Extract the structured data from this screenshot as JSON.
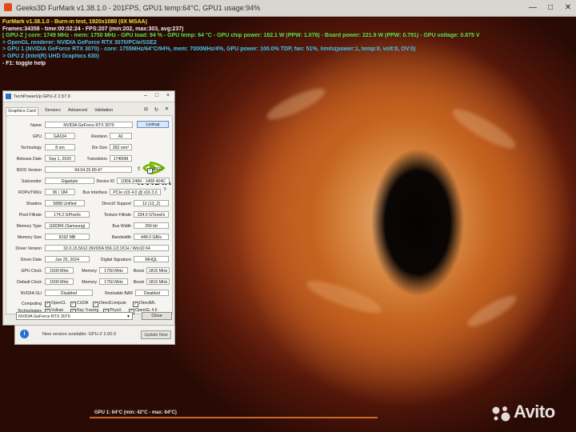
{
  "window": {
    "title": "Geeks3D FurMark v1.38.1.0 - 201FPS, GPU1 temp:64°C, GPU1 usage:94%",
    "controls": [
      "—",
      "□",
      "✕"
    ]
  },
  "overlay": {
    "lines": [
      "FurMark v1.38.1.0 - Burn-in test, 1920x1080 (0X MSAA)",
      "Frames:34358 - time:00:02:24 - FPS:207 (min:202, max:303, avg:237)",
      "[ GPU-Z ] core: 1749 MHz - mem: 1750 MHz - GPU load: 94 % - GPU temp: 64 °C - GPU chip power: 182.1 W (PPW: 1.078) - Board power: 221.9 W (PPW: 0.791) - GPU voltage: 0.875 V",
      "> OpenGL renderer: NVIDIA GeForce RTX 3070/PCIe/SSE2",
      "> GPU 1 (NVIDIA GeForce RTX 3070) - core: 1755MHz/64°C/94%, mem: 7000MHz/4%, GPU power: 100.0% TDP, fan: 51%, limits(power:1, temp:0, volt:0, OV:0)",
      "> GPU 2 (Intel(R) UHD Graphics 630)",
      "- F1: toggle help"
    ]
  },
  "gpuz": {
    "title": "TechPowerUp GPU-Z 2.57.0",
    "tabs": [
      "Graphics Card",
      "Sensors",
      "Advanced",
      "Validation"
    ],
    "fields": {
      "name_label": "Name",
      "name": "NVIDIA GeForce RTX 3070",
      "lookup": "Lookup",
      "gpu_label": "GPU",
      "gpu": "GA104",
      "revision_label": "Revision",
      "revision": "A1",
      "technology_label": "Technology",
      "technology": "8 nm",
      "die_size_label": "Die Size",
      "die_size": "392 mm²",
      "release_date_label": "Release Date",
      "release_date": "Sep 1, 2020",
      "transistors_label": "Transistors",
      "transistors": "17400M",
      "bios_label": "BIOS Version",
      "bios": "94.04.25.80.47",
      "uefi": "UEFI",
      "subvendor_label": "Subvendor",
      "subvendor": "Gigabyte",
      "device_id_label": "Device ID",
      "device_id": "10DE 2484 - 1458 404C",
      "rops_label": "ROPs/TMUs",
      "rops": "96 / 184",
      "bus_label": "Bus Interface",
      "bus": "PCIe x16 4.0 @ x16 3.0",
      "shaders_label": "Shaders",
      "shaders": "5888 Unified",
      "directx_label": "DirectX Support",
      "directx": "12 (12_2)",
      "pixel_label": "Pixel Fillrate",
      "pixel": "174.2 GPixel/s",
      "texture_label": "Texture Fillrate",
      "texture": "334.0 GTexel/s",
      "memtype_label": "Memory Type",
      "memtype": "GDDR6 (Samsung)",
      "buswidth_label": "Bus Width",
      "buswidth": "256 bit",
      "memsize_label": "Memory Size",
      "memsize": "8192 MB",
      "bandwidth_label": "Bandwidth",
      "bandwidth": "448.0 GB/s",
      "driver_label": "Driver Version",
      "driver": "32.0.15.5612 (NVIDIA 556.12) DCH / Win10 64",
      "driverdate_label": "Driver Date",
      "driverdate": "Jun 25, 2024",
      "digsig_label": "Digital Signature",
      "digsig": "WHQL",
      "gpuclock_label": "GPU Clock",
      "gpuclock": "1500 MHz",
      "memory_label": "Memory",
      "mem1": "1750 MHz",
      "boost_label": "Boost",
      "boost1": "1815 MHz",
      "defclock_label": "Default Clock",
      "defclock": "1500 MHz",
      "mem2": "1750 MHz",
      "boost2": "1815 MHz",
      "sli_label": "NVIDIA SLI",
      "sli": "Disabled",
      "rebar_label": "Resizable BAR",
      "rebar": "Disabled",
      "computing_label": "Computing",
      "technologies_label": "Technologies",
      "computing": [
        "OpenCL",
        "CUDA",
        "DirectCompute",
        "DirectML"
      ],
      "technologies": [
        "Vulkan",
        "Ray Tracing",
        "PhysX",
        "OpenGL 4.6"
      ]
    },
    "logo_word": "NVIDIA",
    "gpu_select": "NVIDIA GeForce RTX 3070",
    "close": "Close"
  },
  "update": {
    "icon": "i",
    "message": "New version available: GPU-Z 2.60.0",
    "button": "Update Now"
  },
  "bottom": {
    "gpu_stat": "GPU 1: 64°C (min: 42°C - max: 64°C)",
    "watermark": "Avito"
  },
  "colors": {
    "overlay_yellow": "#f4e63a",
    "overlay_green": "#5fe04a",
    "overlay_cyan": "#3ec6f0",
    "nvidia_green": "#76b900",
    "info_blue": "#2b6fce"
  }
}
